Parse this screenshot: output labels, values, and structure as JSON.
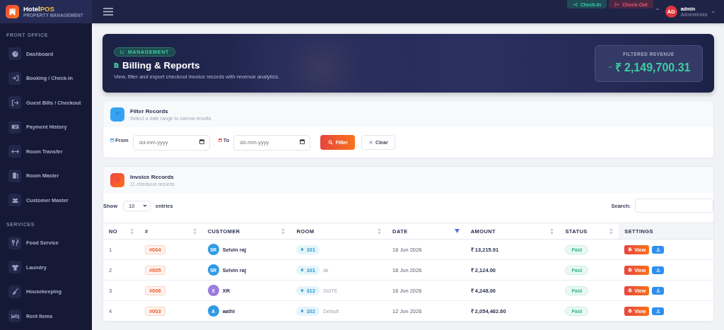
{
  "brand": {
    "name": "Hotel",
    "accent": "POS",
    "subtitle": "PROPERTY MANAGEMENT"
  },
  "sidebar": {
    "sections": [
      {
        "title": "FRONT OFFICE",
        "items": [
          {
            "label": "Dashboard",
            "selected": false
          },
          {
            "label": "Booking / Check-In",
            "selected": false
          },
          {
            "label": "Guest Bills / Checkout",
            "selected": false
          },
          {
            "label": "Payment History",
            "selected": false
          },
          {
            "label": "Room Transfer",
            "selected": false
          },
          {
            "label": "Room Master",
            "selected": false
          },
          {
            "label": "Customer Master",
            "selected": false
          }
        ]
      },
      {
        "title": "SERVICES",
        "items": [
          {
            "label": "Food Service",
            "selected": false
          },
          {
            "label": "Laundry",
            "selected": false
          },
          {
            "label": "Housekeeping",
            "selected": false
          },
          {
            "label": "Rent Items",
            "selected": false
          }
        ]
      }
    ]
  },
  "topbar": {
    "actions": [
      {
        "label": "Check-In",
        "kind": "in"
      },
      {
        "label": "Check-Out",
        "kind": "out"
      }
    ],
    "user": {
      "initials": "AD",
      "name": "admin",
      "role": "Administrator"
    }
  },
  "hero": {
    "badge": "MANAGEMENT",
    "title": "Billing & Reports",
    "subtitle": "View, filter and export checkout invoice records with revenue analytics.",
    "revenue_label": "FILTERED REVENUE",
    "revenue": "₹ 2,149,700.31"
  },
  "filter": {
    "title": "Filter Records",
    "subtitle": "Select a date range to narrow results",
    "from_label": "From",
    "from_placeholder": "dd-mm-yyyy",
    "to_label": "To",
    "to_placeholder": "dd-mm-yyyy",
    "filter_button": "Filter",
    "clear_button": "Clear"
  },
  "invoices": {
    "title": "Invoice Records",
    "subtitle": "11 checkout records",
    "show_label": "Show",
    "page_size": "10",
    "entries_label": "entries",
    "search_label": "Search:",
    "table": {
      "columns": [
        {
          "label": "NO",
          "sortable": true,
          "sorted": false
        },
        {
          "label": "#",
          "sortable": true,
          "sorted": false
        },
        {
          "label": "CUSTOMER",
          "sortable": true,
          "sorted": false
        },
        {
          "label": "ROOM",
          "sortable": true,
          "sorted": false
        },
        {
          "label": "DATE",
          "sortable": true,
          "sorted": true
        },
        {
          "label": "AMOUNT",
          "sortable": true,
          "sorted": false
        },
        {
          "label": "STATUS",
          "sortable": true,
          "sorted": false
        },
        {
          "label": "SETTINGS",
          "sortable": false
        }
      ],
      "rows": [
        {
          "no": "1",
          "invoice": "#004",
          "initials": "SR",
          "customer": "Selvin raj",
          "color": "#2f9be6",
          "room": "101",
          "room_type": "",
          "date": "16 Jun 2026",
          "amount": "₹ 13,215.91",
          "status": "Paid",
          "view": "View"
        },
        {
          "no": "2",
          "invoice": "#005",
          "initials": "SR",
          "customer": "Selvin raj",
          "color": "#2f9be6",
          "room": "101",
          "room_type": "de",
          "date": "16 Jun 2026",
          "amount": "₹ 2,124.00",
          "status": "Paid",
          "view": "View"
        },
        {
          "no": "3",
          "invoice": "#006",
          "initials": "X",
          "customer": "XR",
          "color": "#9b7be0",
          "room": "312",
          "room_type": "SUITE",
          "date": "16 Jun 2026",
          "amount": "₹ 4,248.00",
          "status": "Paid",
          "view": "View"
        },
        {
          "no": "4",
          "invoice": "#003",
          "initials": "A",
          "customer": "aathi",
          "color": "#2f9be6",
          "room": "102",
          "room_type": "Default",
          "date": "12 Jun 2026",
          "amount": "₹ 2,054,462.60",
          "status": "Paid",
          "view": "View"
        }
      ]
    }
  }
}
